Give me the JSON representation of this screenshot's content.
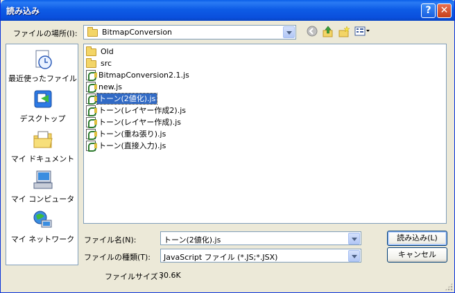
{
  "window": {
    "title": "読み込み",
    "help_glyph": "?",
    "close_glyph": "✕"
  },
  "look_in": {
    "label": "ファイルの場所(I):",
    "value": "BitmapConversion"
  },
  "toolbar": {
    "icons": [
      "back-icon",
      "up-folder-icon",
      "new-folder-icon",
      "views-menu-icon"
    ]
  },
  "places": [
    {
      "label": "最近使ったファイル",
      "icon": "recent-files-icon"
    },
    {
      "label": "デスクトップ",
      "icon": "desktop-icon"
    },
    {
      "label": "マイ ドキュメント",
      "icon": "my-documents-icon"
    },
    {
      "label": "マイ コンピュータ",
      "icon": "my-computer-icon"
    },
    {
      "label": "マイ ネットワーク",
      "icon": "my-network-icon"
    }
  ],
  "files": [
    {
      "name": "Old",
      "type": "folder"
    },
    {
      "name": "src",
      "type": "folder"
    },
    {
      "name": "BitmapConversion2.1.js",
      "type": "js"
    },
    {
      "name": "new.js",
      "type": "js"
    },
    {
      "name": "トーン(2値化).js",
      "type": "js",
      "selected": true
    },
    {
      "name": "トーン(レイヤー作成2).js",
      "type": "js"
    },
    {
      "name": "トーン(レイヤー作成).js",
      "type": "js"
    },
    {
      "name": "トーン(重ね張り).js",
      "type": "js"
    },
    {
      "name": "トーン(直接入力).js",
      "type": "js"
    }
  ],
  "filename": {
    "label": "ファイル名(N):",
    "value": "トーン(2値化).js"
  },
  "filetype": {
    "label": "ファイルの種類(T):",
    "value": "JavaScript ファイル (*.JS;*.JSX)"
  },
  "buttons": {
    "open_label": "読み込み(L)",
    "cancel_label": "キャンセル"
  },
  "filesize": {
    "label": "ファイルサイズ :",
    "value": "30.6K"
  }
}
